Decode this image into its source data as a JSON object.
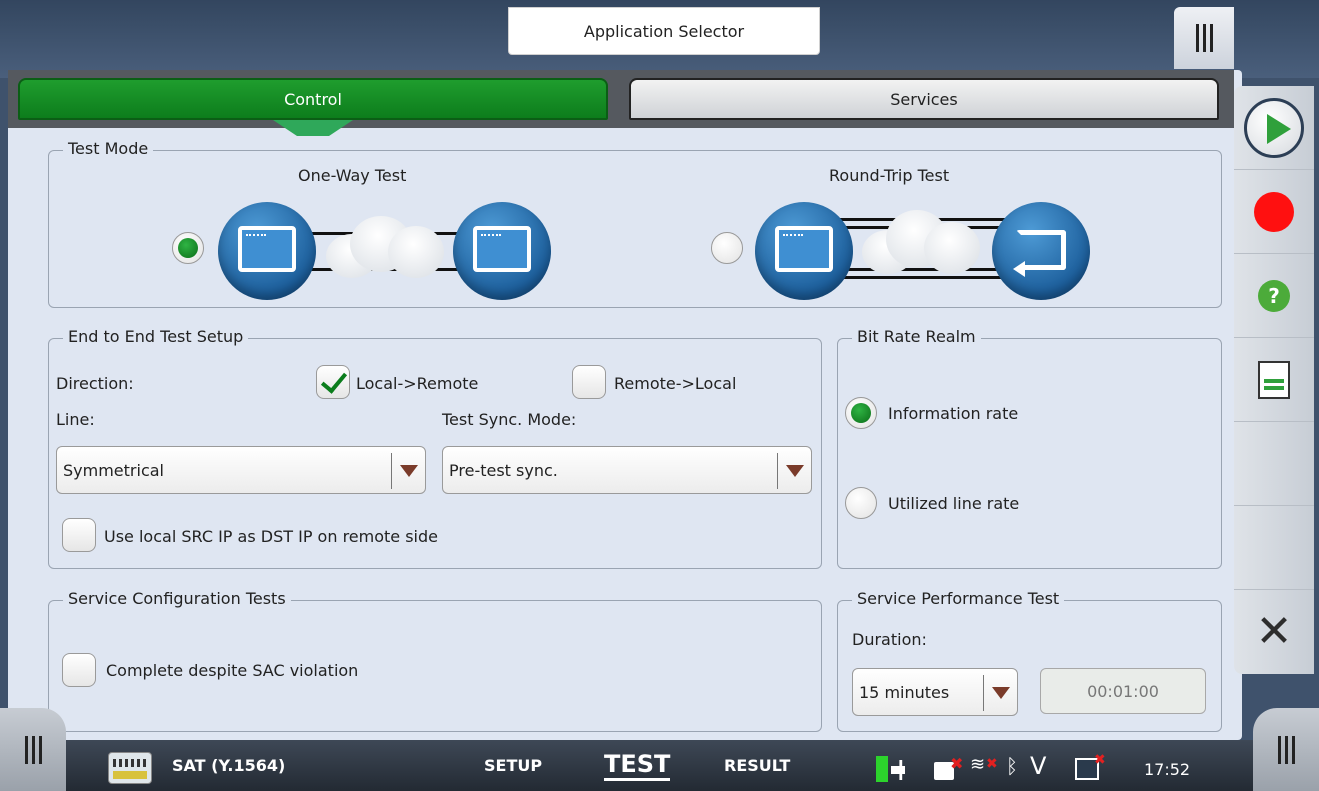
{
  "window": {
    "title": "Application Selector"
  },
  "tabs": [
    {
      "label": "Control",
      "active": true
    },
    {
      "label": "Services",
      "active": false
    }
  ],
  "test_mode": {
    "title": "Test Mode",
    "one_way_label": "One-Way Test",
    "round_trip_label": "Round-Trip Test",
    "selected": "One-Way Test"
  },
  "end_to_end": {
    "title": "End to End Test Setup",
    "direction_label": "Direction:",
    "local_remote_label": "Local->Remote",
    "local_remote_checked": true,
    "remote_local_label": "Remote->Local",
    "remote_local_checked": false,
    "line_label": "Line:",
    "line_value": "Symmetrical",
    "sync_label": "Test Sync. Mode:",
    "sync_value": "Pre-test sync.",
    "use_local_ip_label": "Use local SRC IP as DST IP on remote side",
    "use_local_ip_checked": false
  },
  "bit_rate": {
    "title": "Bit Rate Realm",
    "info_rate_label": "Information rate",
    "utilized_label": "Utilized line rate",
    "selected": "Information rate"
  },
  "service_config": {
    "title": "Service Configuration Tests",
    "complete_label": "Complete despite SAC violation",
    "complete_checked": false
  },
  "service_perf": {
    "title": "Service Performance Test",
    "duration_label": "Duration:",
    "duration_value": "15 minutes",
    "time_value": "00:01:00"
  },
  "status_bar": {
    "app_name": "SAT (Y.1564)",
    "setup_label": "SETUP",
    "test_label": "TEST",
    "result_label": "RESULT",
    "v_label": "V",
    "clock": "17:52"
  },
  "colors": {
    "accent_green": "#0d7d1c",
    "record_red": "#ff1010",
    "panel_bg": "#dfe6f2"
  },
  "icons": {
    "start": "play-icon",
    "record": "record-icon",
    "help": "help-icon",
    "report": "report-icon",
    "close": "close-icon"
  }
}
